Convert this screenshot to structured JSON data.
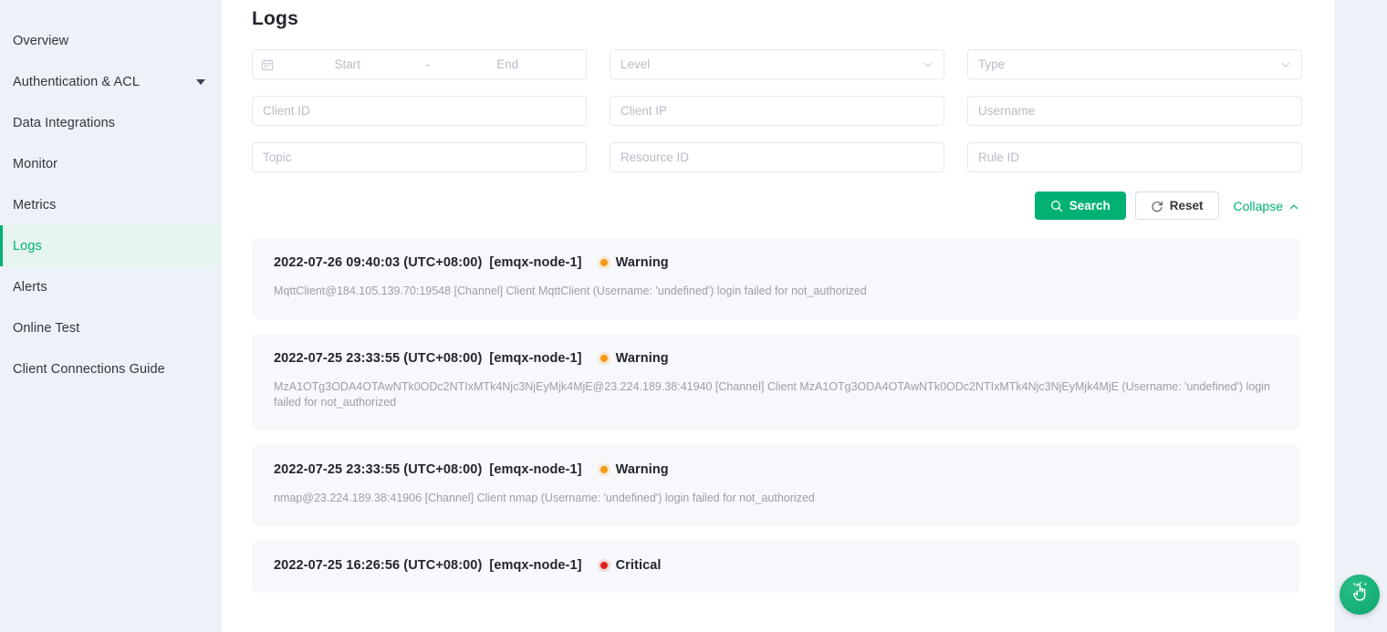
{
  "sidebar": {
    "items": [
      {
        "label": "Overview",
        "active": false,
        "has_caret": false
      },
      {
        "label": "Authentication & ACL",
        "active": false,
        "has_caret": true
      },
      {
        "label": "Data Integrations",
        "active": false,
        "has_caret": false
      },
      {
        "label": "Monitor",
        "active": false,
        "has_caret": false
      },
      {
        "label": "Metrics",
        "active": false,
        "has_caret": false
      },
      {
        "label": "Logs",
        "active": true,
        "has_caret": false
      },
      {
        "label": "Alerts",
        "active": false,
        "has_caret": false
      },
      {
        "label": "Online Test",
        "active": false,
        "has_caret": false
      },
      {
        "label": "Client Connections Guide",
        "active": false,
        "has_caret": false
      }
    ]
  },
  "page": {
    "title": "Logs"
  },
  "filters": {
    "date_range": {
      "start_placeholder": "Start",
      "separator": "-",
      "end_placeholder": "End",
      "icon": "calendar-icon"
    },
    "level": {
      "placeholder": "Level",
      "value": "",
      "icon": "chevron-down-icon"
    },
    "type": {
      "placeholder": "Type",
      "value": "",
      "icon": "chevron-down-icon"
    },
    "client_id": {
      "placeholder": "Client ID",
      "value": ""
    },
    "client_ip": {
      "placeholder": "Client IP",
      "value": ""
    },
    "username": {
      "placeholder": "Username",
      "value": ""
    },
    "topic": {
      "placeholder": "Topic",
      "value": ""
    },
    "resource_id": {
      "placeholder": "Resource ID",
      "value": ""
    },
    "rule_id": {
      "placeholder": "Rule ID",
      "value": ""
    }
  },
  "actions": {
    "search_label": "Search",
    "search_icon": "search-icon",
    "reset_label": "Reset",
    "reset_icon": "refresh-icon",
    "collapse_label": "Collapse",
    "collapse_icon": "chevron-up-icon"
  },
  "logs": [
    {
      "time": "2022-07-26 09:40:03 (UTC+08:00)",
      "node": "[emqx-node-1]",
      "level": "Warning",
      "level_kind": "warning",
      "message": "MqttClient@184.105.139.70:19548 [Channel] Client MqttClient (Username: 'undefined') login failed for not_authorized"
    },
    {
      "time": "2022-07-25 23:33:55 (UTC+08:00)",
      "node": "[emqx-node-1]",
      "level": "Warning",
      "level_kind": "warning",
      "message": "MzA1OTg3ODA4OTAwNTk0ODc2NTIxMTk4Njc3NjEyMjk4MjE@23.224.189.38:41940 [Channel] Client MzA1OTg3ODA4OTAwNTk0ODc2NTIxMTk4Njc3NjEyMjk4MjE (Username: 'undefined') login failed for not_authorized"
    },
    {
      "time": "2022-07-25 23:33:55 (UTC+08:00)",
      "node": "[emqx-node-1]",
      "level": "Warning",
      "level_kind": "warning",
      "message": "nmap@23.224.189.38:41906 [Channel] Client nmap (Username: 'undefined') login failed for not_authorized"
    },
    {
      "time": "2022-07-25 16:26:56 (UTC+08:00)",
      "node": "[emqx-node-1]",
      "level": "Critical",
      "level_kind": "critical",
      "message": ""
    }
  ],
  "fab": {
    "icon": "tap-gesture-icon"
  },
  "colors": {
    "accent": "#00b173",
    "warning": "#f59a17",
    "critical": "#e02020",
    "sidebar_bg": "#edf2f9",
    "card_bg": "#f7f8fb"
  }
}
